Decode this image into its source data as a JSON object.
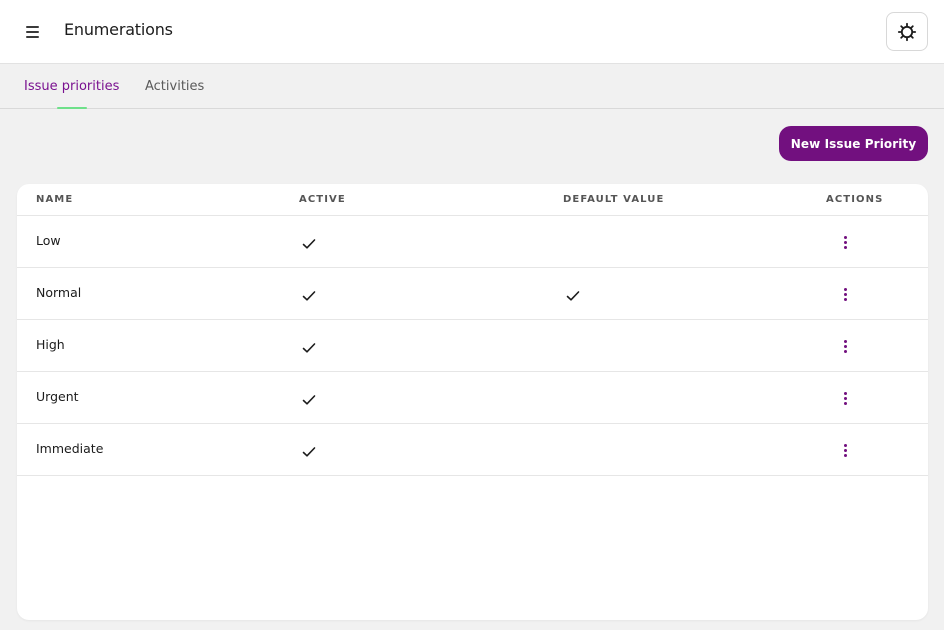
{
  "header": {
    "title": "Enumerations",
    "menu_icon": "hamburger-menu-icon",
    "settings_icon": "gear-icon"
  },
  "tabs": [
    {
      "label": "Issue priorities",
      "active": true
    },
    {
      "label": "Activities",
      "active": false
    }
  ],
  "toolbar": {
    "new_label": "New Issue Priority"
  },
  "table": {
    "columns": [
      "NAME",
      "ACTIVE",
      "DEFAULT VALUE",
      "ACTIONS"
    ],
    "rows": [
      {
        "name": "Low",
        "active": true,
        "default": false
      },
      {
        "name": "Normal",
        "active": true,
        "default": true
      },
      {
        "name": "High",
        "active": true,
        "default": false
      },
      {
        "name": "Urgent",
        "active": true,
        "default": false
      },
      {
        "name": "Immediate",
        "active": true,
        "default": false
      }
    ]
  },
  "colors": {
    "accent": "#72107f",
    "tab_active_text": "#7a1190",
    "tab_indicator": "#6ee08a",
    "background": "#f1f1f1"
  }
}
